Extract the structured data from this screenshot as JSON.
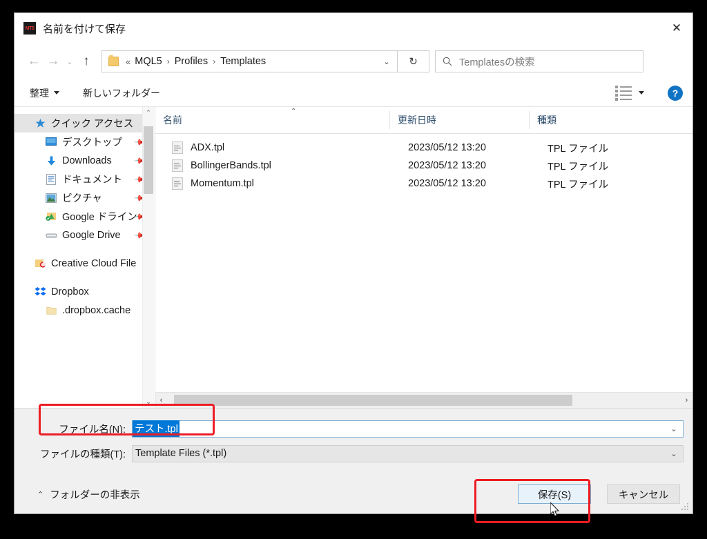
{
  "window": {
    "title": "名前を付けて保存",
    "app_icon": "mt5-icon",
    "close_label": "✕"
  },
  "navbar": {
    "back_label": "←",
    "forward_label": "→",
    "recent_label": "⌄",
    "up_label": "↑",
    "breadcrumb_lead": "«",
    "breadcrumbs": [
      "MQL5",
      "Profiles",
      "Templates"
    ],
    "breadcrumb_separator": "›",
    "dropdown_label": "⌄",
    "refresh_label": "↻",
    "search_placeholder": "Templatesの検索",
    "search_value": ""
  },
  "toolbar": {
    "organize_label": "整理",
    "new_folder_label": "新しいフォルダー",
    "view_label": "view-list",
    "view_dropdown_label": "▾",
    "help_label": "?"
  },
  "sidebar": {
    "items": [
      {
        "label": "クイック アクセス",
        "icon": "star-icon",
        "indent": 0,
        "selected": true,
        "pinned": false
      },
      {
        "label": "デスクトップ",
        "icon": "desktop-icon",
        "indent": 1,
        "selected": false,
        "pinned": true
      },
      {
        "label": "Downloads",
        "icon": "download-icon",
        "indent": 1,
        "selected": false,
        "pinned": true
      },
      {
        "label": "ドキュメント",
        "icon": "document-icon",
        "indent": 1,
        "selected": false,
        "pinned": true
      },
      {
        "label": "ピクチャ",
        "icon": "picture-icon",
        "indent": 1,
        "selected": false,
        "pinned": true
      },
      {
        "label": "Google ドライン",
        "icon": "google-drive-sync-icon",
        "indent": 1,
        "selected": false,
        "pinned": true
      },
      {
        "label": "Google Drive",
        "icon": "drive-disk-icon",
        "indent": 1,
        "selected": false,
        "pinned": true
      },
      {
        "label": "Creative Cloud File",
        "icon": "creative-cloud-icon",
        "indent": 0,
        "selected": false,
        "pinned": false
      },
      {
        "label": "Dropbox",
        "icon": "dropbox-icon",
        "indent": 0,
        "selected": false,
        "pinned": false
      },
      {
        "label": ".dropbox.cache",
        "icon": "folder-icon",
        "indent": 1,
        "selected": false,
        "pinned": false
      }
    ],
    "scroll_up_label": "⌃",
    "scroll_down_label": "⌄"
  },
  "filelist": {
    "columns": [
      "名前",
      "更新日時",
      "種類"
    ],
    "sort_indicator": "⌃",
    "rows": [
      {
        "name": "ADX.tpl",
        "date": "2023/05/12 13:20",
        "type": "TPL ファイル",
        "icon": "tpl-file-icon"
      },
      {
        "name": "BollingerBands.tpl",
        "date": "2023/05/12 13:20",
        "type": "TPL ファイル",
        "icon": "tpl-file-icon"
      },
      {
        "name": "Momentum.tpl",
        "date": "2023/05/12 13:20",
        "type": "TPL ファイル",
        "icon": "tpl-file-icon"
      }
    ],
    "hscroll_left_label": "‹",
    "hscroll_right_label": "›"
  },
  "form": {
    "filename_label": "ファイル名(N):",
    "filename_value": "テスト.tpl",
    "filename_dropdown_label": "⌄",
    "filetype_label": "ファイルの種類(T):",
    "filetype_value": "Template Files (*.tpl)",
    "filetype_dropdown_label": "⌄"
  },
  "footer": {
    "hide_folders_label": "フォルダーの非表示",
    "hide_folders_chevron": "⌃",
    "save_label": "保存(S)",
    "cancel_label": "キャンセル"
  },
  "annotations": {
    "highlight_color": "#ed1c24",
    "selection_color": "#0078d7",
    "accent_color": "#1173c3"
  }
}
